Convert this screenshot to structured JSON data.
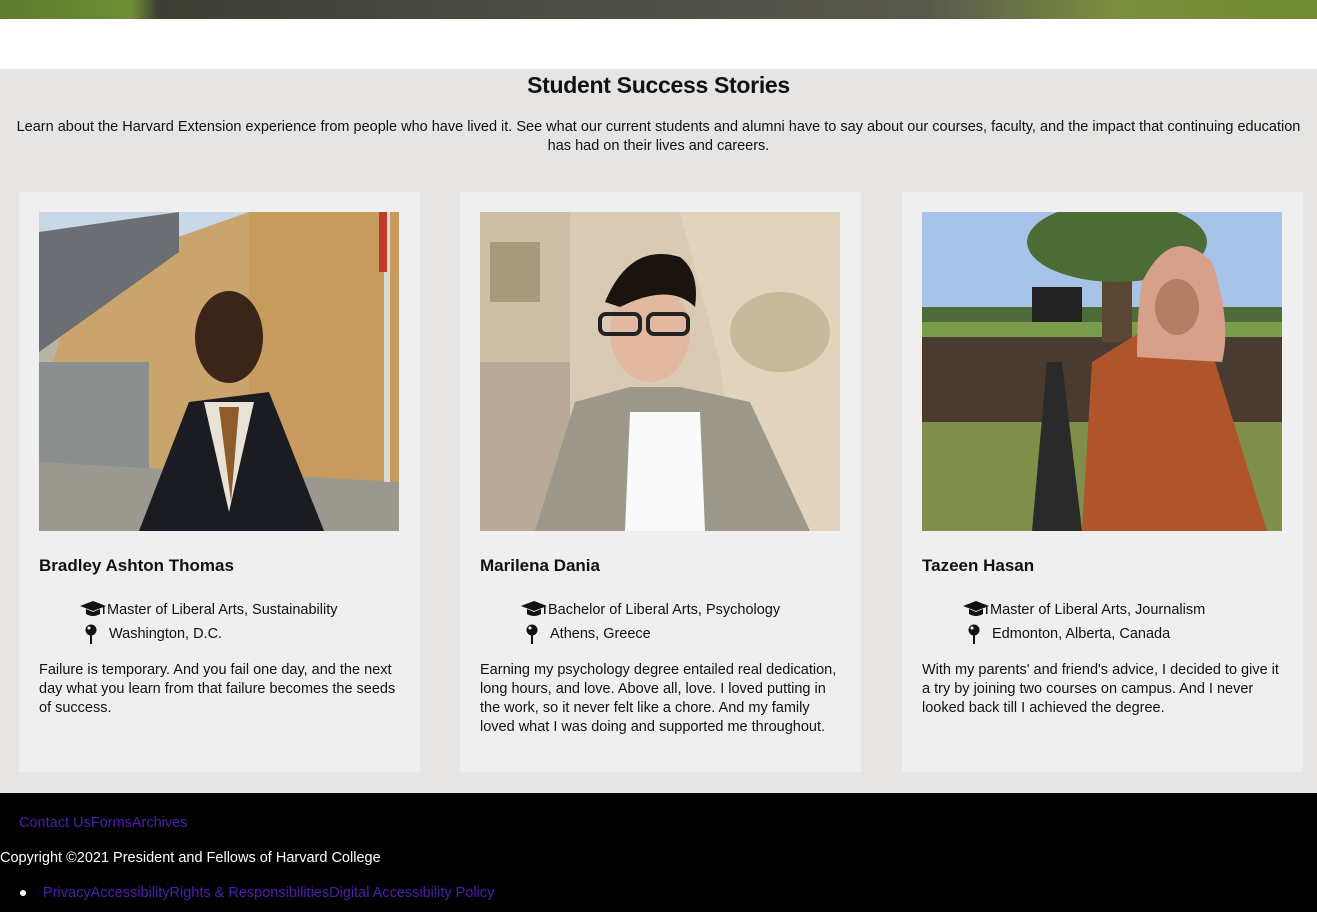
{
  "section": {
    "title": "Student Success Stories",
    "intro": "Learn about the Harvard Extension experience from people who have lived it. See what our current students and alumni have to say about our courses, faculty, and the impact that continuing education has had on their lives and careers."
  },
  "stories": [
    {
      "name": "Bradley Ashton Thomas",
      "degree": "Master of Liberal Arts, Sustainability",
      "location": "Washington, D.C.",
      "quote": "Failure is temporary. And you fail one day, and the next day what you learn from that failure becomes the seeds of success."
    },
    {
      "name": "Marilena Dania",
      "degree": "Bachelor of Liberal Arts, Psychology",
      "location": "Athens, Greece",
      "quote": "Earning my psychology degree entailed real dedication, long hours, and love. Above all, love. I loved putting in the work, so it never felt like a chore. And my family loved what I was doing and supported me throughout."
    },
    {
      "name": "Tazeen Hasan",
      "degree": "Master of Liberal Arts, Journalism",
      "location": "Edmonton, Alberta, Canada",
      "quote": "With my parents' and friend's advice, I decided to give it a try by joining two courses on campus. And I never looked back till I achieved the degree."
    }
  ],
  "footer": {
    "links": [
      "Contact Us",
      "Forms",
      "Archives"
    ],
    "copyright": "Copyright ©2021 President and Fellows of Harvard College",
    "legal": [
      "Privacy",
      "Accessibility",
      "Rights & Responsibilities",
      "Digital Accessibility Policy"
    ]
  },
  "icons": {
    "degree": "graduation-cap-icon",
    "location": "map-pin-icon"
  },
  "colors": {
    "section_bg": "#e6e5e3",
    "card_bg": "#efefef",
    "footer_bg": "#000000",
    "link": "#4b1fb3"
  }
}
